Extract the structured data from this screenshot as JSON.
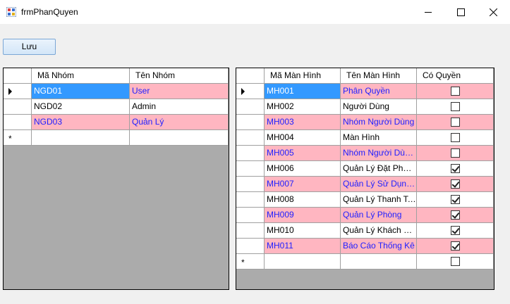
{
  "window": {
    "title": "frmPhanQuyen"
  },
  "toolbar": {
    "save_label": "Lưu"
  },
  "groups": {
    "columns": [
      "Mã Nhóm",
      "Tên Nhóm"
    ],
    "rows": [
      {
        "code": "NGD01",
        "name": "User"
      },
      {
        "code": "NGD02",
        "name": "Admin"
      },
      {
        "code": "NGD03",
        "name": "Quản Lý"
      }
    ]
  },
  "screens": {
    "columns": [
      "Mã Màn Hình",
      "Tên Màn Hình",
      "Có Quyền"
    ],
    "rows": [
      {
        "code": "MH001",
        "name": "Phân Quyền",
        "allowed": false
      },
      {
        "code": "MH002",
        "name": "Người Dùng",
        "allowed": false
      },
      {
        "code": "MH003",
        "name": "Nhóm Người Dùng",
        "allowed": false
      },
      {
        "code": "MH004",
        "name": "Màn Hình",
        "allowed": false
      },
      {
        "code": "MH005",
        "name": "Nhóm Người Dùng ...",
        "allowed": false
      },
      {
        "code": "MH006",
        "name": "Quản Lý Đặt Phòng",
        "allowed": true
      },
      {
        "code": "MH007",
        "name": "Quản Lý Sử Dụng ...",
        "allowed": true
      },
      {
        "code": "MH008",
        "name": "Quản Lý Thanh To...",
        "allowed": true
      },
      {
        "code": "MH009",
        "name": "Quản Lý Phòng",
        "allowed": true
      },
      {
        "code": "MH010",
        "name": "Quản Lý Khách Hà...",
        "allowed": true
      },
      {
        "code": "MH011",
        "name": "Báo Cáo Thống Kê",
        "allowed": true
      }
    ]
  },
  "icons": {
    "app": "form-icon",
    "minimize": "minimize-icon",
    "maximize": "maximize-icon",
    "close": "close-icon",
    "current_row": "row-pointer-icon",
    "new_row": "new-row-star-icon"
  },
  "colors": {
    "alt_row_bg": "#ffb6c1",
    "alt_row_text": "#2020ff",
    "selection": "#3399ff",
    "grid_empty": "#ababab"
  }
}
